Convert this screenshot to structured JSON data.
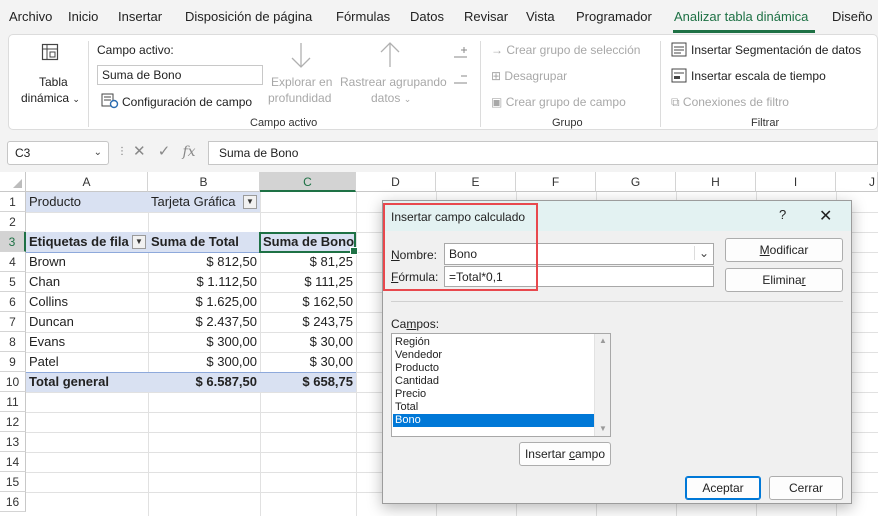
{
  "menu": {
    "items": [
      "Archivo",
      "Inicio",
      "Insertar",
      "Disposición de página",
      "Fórmulas",
      "Datos",
      "Revisar",
      "Vista",
      "Programador",
      "Analizar tabla dinámica",
      "Diseño"
    ],
    "active": "Analizar tabla dinámica",
    "accent_color": "#1e7145"
  },
  "ribbon": {
    "pivot_label_line1": "Tabla",
    "pivot_label_line2": "dinámica",
    "active_field_label": "Campo activo:",
    "active_field_value": "Suma de Bono",
    "field_settings": "Configuración de campo",
    "drill_down_line1": "Explorar en",
    "drill_down_line2": "profundidad",
    "drill_up_line1": "Rastrear agrupando",
    "drill_up_line2": "datos",
    "group_active_field": "Campo activo",
    "create_group_selection": "Crear grupo de selección",
    "ungroup": "Desagrupar",
    "create_group_field": "Crear grupo de campo",
    "group_group": "Grupo",
    "insert_slicer": "Insertar Segmentación de datos",
    "insert_timeline": "Insertar escala de tiempo",
    "filter_connections": "Conexiones de filtro",
    "group_filter": "Filtrar"
  },
  "formula_bar": {
    "name_box": "C3",
    "formula": "Suma de Bono",
    "fx": "fx"
  },
  "grid": {
    "columns": [
      "A",
      "B",
      "C",
      "D",
      "E",
      "F",
      "G",
      "H",
      "I",
      "J"
    ],
    "rows": [
      "1",
      "2",
      "3",
      "4",
      "5",
      "6",
      "7",
      "8",
      "9",
      "10",
      "11",
      "12",
      "13",
      "14",
      "15",
      "16"
    ],
    "a1": "Producto",
    "b1": "Tarjeta Gráfica",
    "header_row": [
      "Etiquetas de fila",
      "Suma de Total",
      "Suma de Bono"
    ],
    "data_rows": [
      [
        "Brown",
        "$ 812,50",
        "$ 81,25"
      ],
      [
        "Chan",
        "$ 1.112,50",
        "$ 111,25"
      ],
      [
        "Collins",
        "$ 1.625,00",
        "$ 162,50"
      ],
      [
        "Duncan",
        "$ 2.437,50",
        "$ 243,75"
      ],
      [
        "Evans",
        "$ 300,00",
        "$ 30,00"
      ],
      [
        "Patel",
        "$ 300,00",
        "$ 30,00"
      ]
    ],
    "total_row": [
      "Total general",
      "$ 6.587,50",
      "$ 658,75"
    ]
  },
  "dialog": {
    "title": "Insertar campo calculado",
    "help": "?",
    "close": "✕",
    "name_label_u": "N",
    "name_label_rest": "ombre:",
    "name_value": "Bono",
    "formula_label_u": "F",
    "formula_label_rest": "órmula:",
    "formula_value": "=Total*0,1",
    "modify_u": "M",
    "modify_rest": "odificar",
    "delete_pre": "Elimina",
    "delete_u": "r",
    "fields_pre": "Ca",
    "fields_u": "m",
    "fields_rest": "pos:",
    "fields": [
      "Región",
      "Vendedor",
      "Producto",
      "Cantidad",
      "Precio",
      "Total",
      "Bono"
    ],
    "selected_field": "Bono",
    "insert_pre": "Insertar ",
    "insert_u": "c",
    "insert_rest": "ampo",
    "accept": "Aceptar",
    "close_btn": "Cerrar",
    "highlight_color": "#e8484d",
    "selection_color": "#0078d7"
  }
}
